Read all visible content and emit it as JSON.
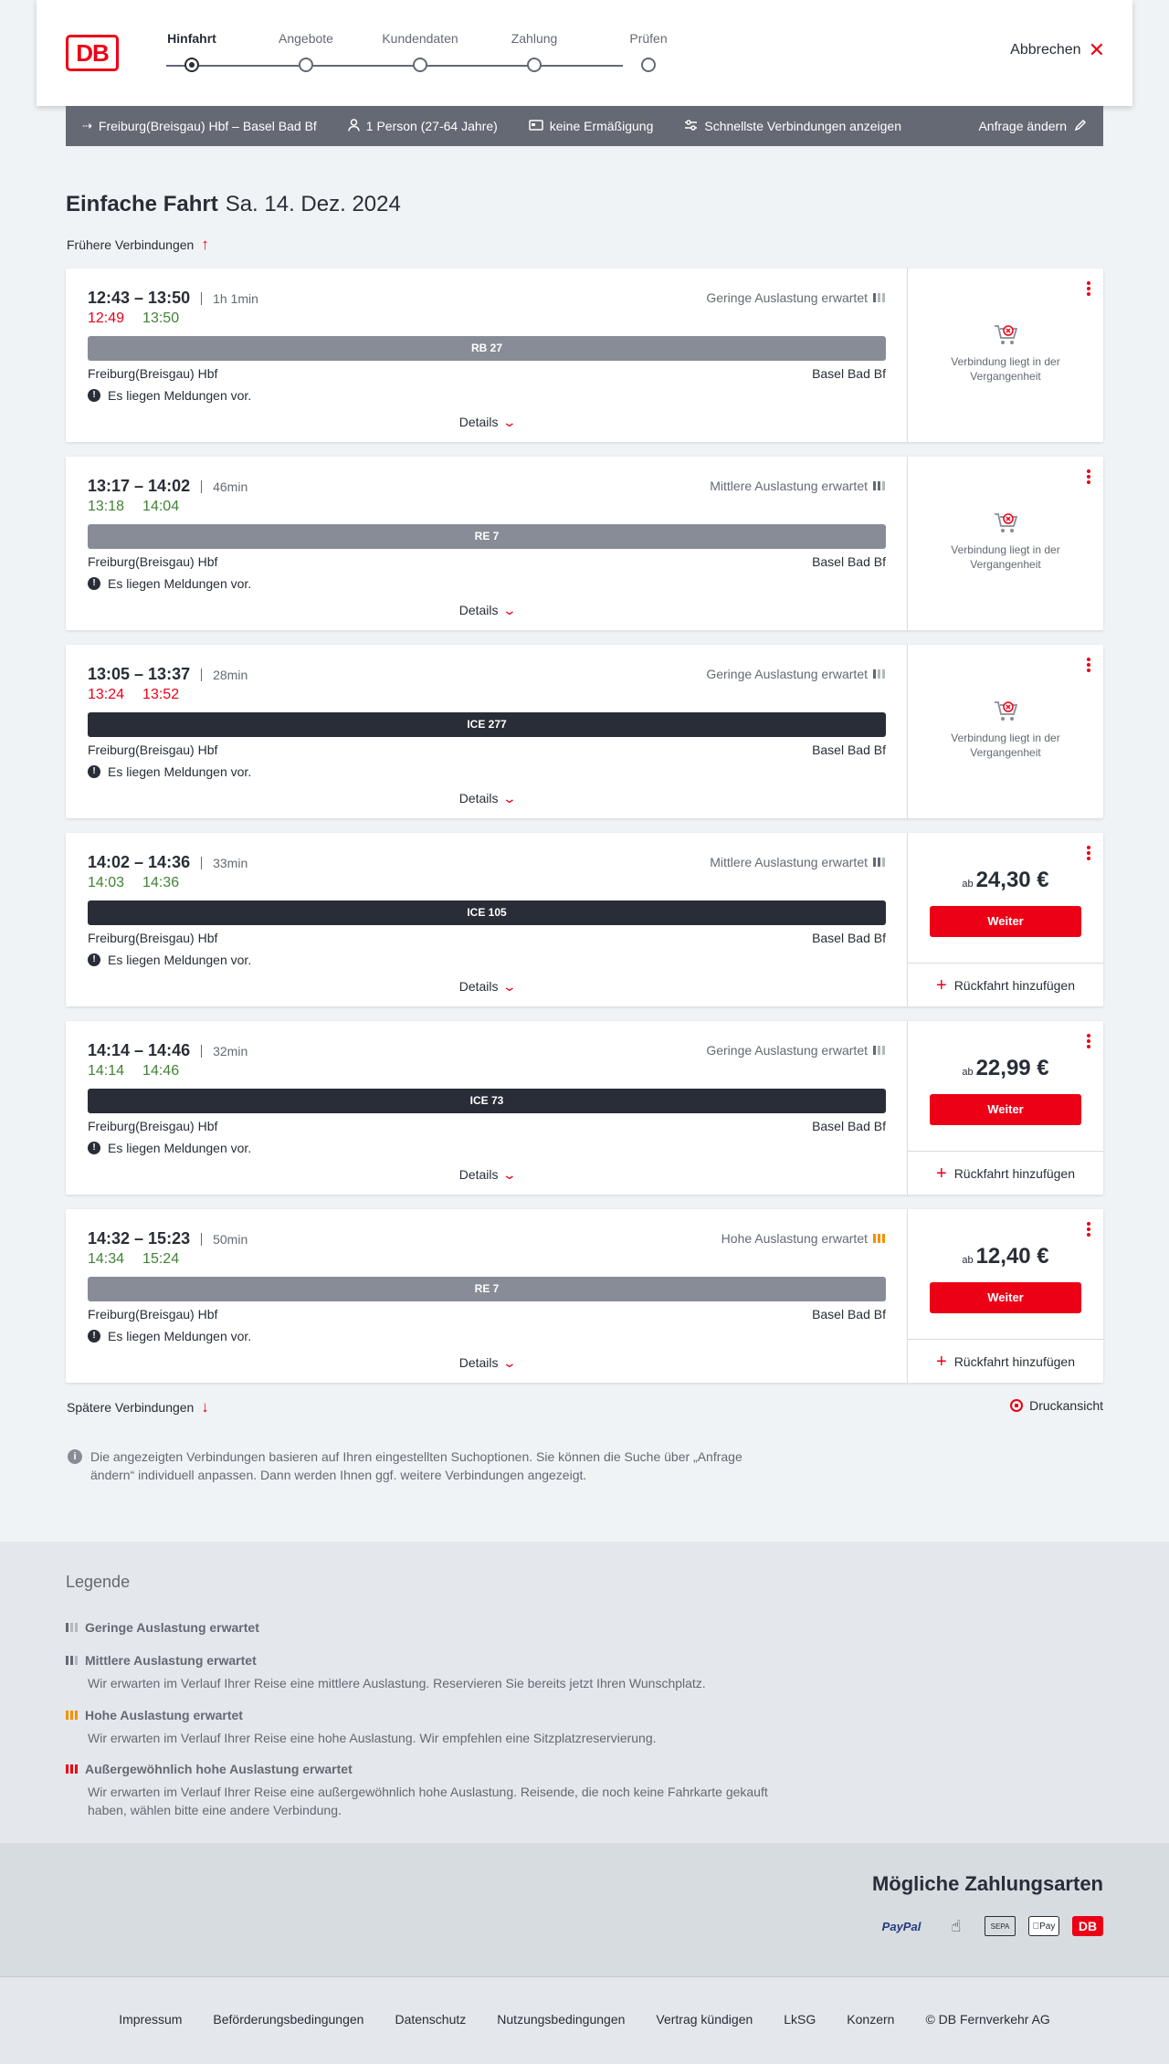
{
  "header": {
    "logo": "DB",
    "steps": [
      "Hinfahrt",
      "Angebote",
      "Kundendaten",
      "Zahlung",
      "Prüfen"
    ],
    "cancel_label": "Abbrechen"
  },
  "searchbar": {
    "route": "Freiburg(Breisgau) Hbf – Basel Bad Bf",
    "passengers": "1 Person (27-64 Jahre)",
    "discount": "keine Ermäßigung",
    "fastest": "Schnellste Verbindungen anzeigen",
    "edit_label": "Anfrage ändern"
  },
  "title": {
    "trip_type": "Einfache Fahrt",
    "date": "Sa. 14. Dez. 2024"
  },
  "earlier_label": "Frühere Verbindungen",
  "later_label": "Spätere Verbindungen",
  "print_label": "Druckansicht",
  "connections": [
    {
      "times": "12:43 – 13:50",
      "duration": "1h 1min",
      "rt_dep": "12:49",
      "rt_dep_status": "late",
      "rt_arr": "13:50",
      "rt_arr_status": "ontime",
      "load": "Geringe Auslastung erwartet",
      "load_level": 1,
      "train": "RB 27",
      "train_type": "regio",
      "from": "Freiburg(Breisgau) Hbf",
      "to": "Basel Bad Bf",
      "notice": "Es liegen Meldungen vor.",
      "details": "Details",
      "past": "Verbindung liegt in der Vergangenheit"
    },
    {
      "times": "13:17 – 14:02",
      "duration": "46min",
      "rt_dep": "13:18",
      "rt_dep_status": "ontime",
      "rt_arr": "14:04",
      "rt_arr_status": "ontime",
      "load": "Mittlere Auslastung erwartet",
      "load_level": 2,
      "train": "RE 7",
      "train_type": "regio",
      "from": "Freiburg(Breisgau) Hbf",
      "to": "Basel Bad Bf",
      "notice": "Es liegen Meldungen vor.",
      "details": "Details",
      "past": "Verbindung liegt in der Vergangenheit"
    },
    {
      "times": "13:05 – 13:37",
      "duration": "28min",
      "rt_dep": "13:24",
      "rt_dep_status": "late",
      "rt_arr": "13:52",
      "rt_arr_status": "late",
      "load": "Geringe Auslastung erwartet",
      "load_level": 1,
      "train": "ICE 277",
      "train_type": "ice",
      "from": "Freiburg(Breisgau) Hbf",
      "to": "Basel Bad Bf",
      "notice": "Es liegen Meldungen vor.",
      "details": "Details",
      "past": "Verbindung liegt in der Vergangenheit"
    },
    {
      "times": "14:02 – 14:36",
      "duration": "33min",
      "rt_dep": "14:03",
      "rt_dep_status": "ontime",
      "rt_arr": "14:36",
      "rt_arr_status": "ontime",
      "load": "Mittlere Auslastung erwartet",
      "load_level": 2,
      "train": "ICE 105",
      "train_type": "ice",
      "from": "Freiburg(Breisgau) Hbf",
      "to": "Basel Bad Bf",
      "notice": "Es liegen Meldungen vor.",
      "details": "Details",
      "price_prefix": "ab",
      "price": "24,30 €",
      "button": "Weiter",
      "return": "Rückfahrt hinzufügen"
    },
    {
      "times": "14:14 – 14:46",
      "duration": "32min",
      "rt_dep": "14:14",
      "rt_dep_status": "ontime",
      "rt_arr": "14:46",
      "rt_arr_status": "ontime",
      "load": "Geringe Auslastung erwartet",
      "load_level": 1,
      "train": "ICE 73",
      "train_type": "ice",
      "from": "Freiburg(Breisgau) Hbf",
      "to": "Basel Bad Bf",
      "notice": "Es liegen Meldungen vor.",
      "details": "Details",
      "price_prefix": "ab",
      "price": "22,99 €",
      "button": "Weiter",
      "return": "Rückfahrt hinzufügen"
    },
    {
      "times": "14:32 – 15:23",
      "duration": "50min",
      "rt_dep": "14:34",
      "rt_dep_status": "ontime",
      "rt_arr": "15:24",
      "rt_arr_status": "ontime",
      "load": "Hohe Auslastung erwartet",
      "load_level": 3,
      "train": "RE 7",
      "train_type": "regio",
      "from": "Freiburg(Breisgau) Hbf",
      "to": "Basel Bad Bf",
      "notice": "Es liegen Meldungen vor.",
      "details": "Details",
      "price_prefix": "ab",
      "price": "12,40 €",
      "button": "Weiter",
      "return": "Rückfahrt hinzufügen"
    }
  ],
  "info_text": "Die angezeigten Verbindungen basieren auf Ihren eingestellten Suchoptionen. Sie können die Suche über „Anfrage ändern“ individuell anpassen. Dann werden Ihnen ggf. weitere Verbindungen angezeigt.",
  "legend": {
    "title": "Legende",
    "items": [
      {
        "label": "Geringe Auslastung erwartet",
        "text": ""
      },
      {
        "label": "Mittlere Auslastung erwartet",
        "text": "Wir erwarten im Verlauf Ihrer Reise eine mittlere Auslastung. Reservieren Sie bereits jetzt Ihren Wunschplatz."
      },
      {
        "label": "Hohe Auslastung erwartet",
        "text": "Wir erwarten im Verlauf Ihrer Reise eine hohe Auslastung. Wir empfehlen eine Sitzplatzreservierung."
      },
      {
        "label": "Außergewöhnlich hohe Auslastung erwartet",
        "text": "Wir erwarten im Verlauf Ihrer Reise eine außergewöhnlich hohe Auslastung. Reisende, die noch keine Fahrkarte gekauft haben, wählen bitte eine andere Verbindung."
      }
    ]
  },
  "payments": {
    "title": "Mögliche Zahlungsarten",
    "methods": [
      "PayPal",
      "SEPA",
      "Pay",
      "DB"
    ]
  },
  "footer": {
    "links": [
      "Impressum",
      "Beförderungsbedingungen",
      "Datenschutz",
      "Nutzungsbedingungen",
      "Vertrag kündigen",
      "LkSG",
      "Konzern",
      "© DB Fernverkehr AG"
    ]
  },
  "colors": {
    "brand": "#ec0016",
    "ontime": "#408335",
    "late": "#ec0016",
    "high_load": "#f39200"
  }
}
